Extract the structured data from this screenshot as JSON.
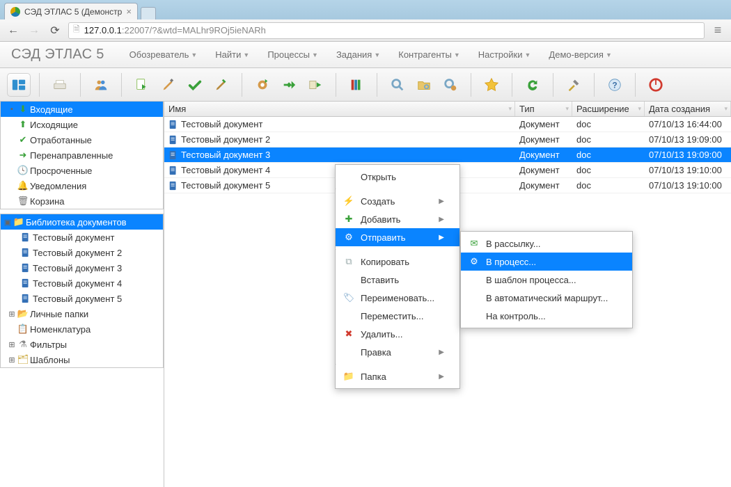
{
  "tab_title": "СЭД ЭTЛАС 5 (Демонстр",
  "url_host": "127.0.0.1",
  "url_port_path": ":22007/?&wtd=MALhr9ROj5ieNARh",
  "app_title": "СЭД ЭТЛАС 5",
  "main_menu": {
    "browser": "Обозреватель",
    "find": "Найти",
    "processes": "Процессы",
    "tasks": "Задания",
    "contractors": "Контрагенты",
    "settings": "Настройки",
    "demo": "Демо-версия"
  },
  "sidebar": {
    "block1": {
      "incoming": "Входящие",
      "outgoing": "Исходящие",
      "processed": "Отработанные",
      "forwarded": "Перенаправленные",
      "overdue": "Просроченные",
      "notifications": "Уведомления",
      "trash": "Корзина"
    },
    "block2": {
      "lib": "Библиотека документов",
      "docs": [
        "Тестовый документ",
        "Тестовый документ 2",
        "Тестовый документ 3",
        "Тестовый документ 4",
        "Тестовый документ 5"
      ],
      "personal": "Личные папки",
      "nomen": "Номенклатура",
      "filters": "Фильтры",
      "templates": "Шаблоны"
    }
  },
  "columns": {
    "name": "Имя",
    "type": "Тип",
    "ext": "Расширение",
    "date": "Дата создания"
  },
  "rows": [
    {
      "name": "Тестовый документ",
      "type": "Документ",
      "ext": "doc",
      "date": "07/10/13 16:44:00"
    },
    {
      "name": "Тестовый документ 2",
      "type": "Документ",
      "ext": "doc",
      "date": "07/10/13 19:09:00"
    },
    {
      "name": "Тестовый документ 3",
      "type": "Документ",
      "ext": "doc",
      "date": "07/10/13 19:09:00"
    },
    {
      "name": "Тестовый документ 4",
      "type": "Документ",
      "ext": "doc",
      "date": "07/10/13 19:10:00"
    },
    {
      "name": "Тестовый документ 5",
      "type": "Документ",
      "ext": "doc",
      "date": "07/10/13 19:10:00"
    }
  ],
  "ctx": {
    "open": "Открыть",
    "create": "Создать",
    "add": "Добавить",
    "send": "Отправить",
    "copy": "Копировать",
    "paste": "Вставить",
    "rename": "Переименовать...",
    "move": "Переместить...",
    "delete": "Удалить...",
    "edit": "Правка",
    "folder": "Папка"
  },
  "sub": {
    "mailing": "В рассылку...",
    "process": "В процесс...",
    "ptemplate": "В шаблон процесса...",
    "autoroute": "В автоматический маршрут...",
    "control": "На контроль..."
  }
}
